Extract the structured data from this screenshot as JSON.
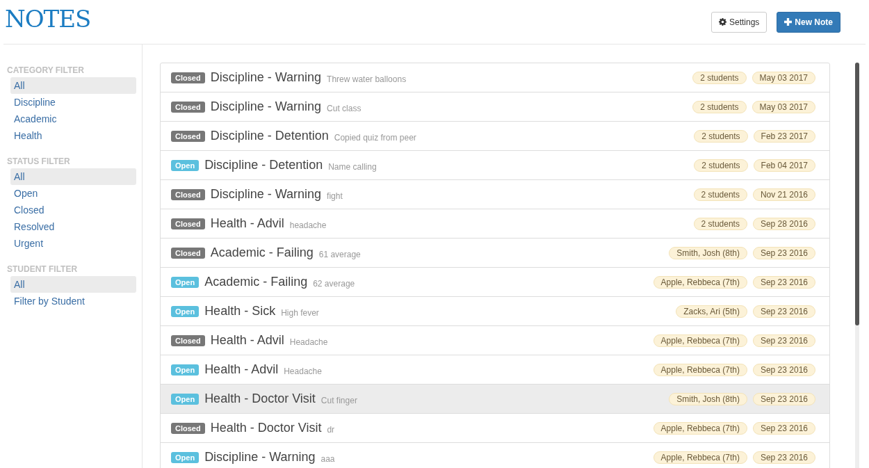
{
  "header": {
    "title": "NOTES",
    "buttons": [
      {
        "kind": "settings",
        "label": "Settings"
      },
      {
        "kind": "primary",
        "label": "New Note"
      }
    ]
  },
  "sidebar": {
    "sections": [
      {
        "heading": "CATEGORY FILTER",
        "items": [
          {
            "label": "All",
            "selected": true
          },
          {
            "label": "Discipline",
            "selected": false
          },
          {
            "label": "Academic",
            "selected": false
          },
          {
            "label": "Health",
            "selected": false
          }
        ]
      },
      {
        "heading": "STATUS FILTER",
        "items": [
          {
            "label": "All",
            "selected": true
          },
          {
            "label": "Open",
            "selected": false
          },
          {
            "label": "Closed",
            "selected": false
          },
          {
            "label": "Resolved",
            "selected": false
          },
          {
            "label": "Urgent",
            "selected": false
          }
        ]
      },
      {
        "heading": "STUDENT FILTER",
        "items": [
          {
            "label": "All",
            "selected": true
          },
          {
            "label": "Filter by Student",
            "selected": false
          }
        ]
      }
    ]
  },
  "notes": [
    {
      "status": "Closed",
      "title": "Discipline - Warning",
      "detail": "Threw water balloons",
      "students": "2 students",
      "date": "May 03 2017",
      "selected": false
    },
    {
      "status": "Closed",
      "title": "Discipline - Warning",
      "detail": "Cut class",
      "students": "2 students",
      "date": "May 03 2017",
      "selected": false
    },
    {
      "status": "Closed",
      "title": "Discipline - Detention",
      "detail": "Copied quiz from peer",
      "students": "2 students",
      "date": "Feb 23 2017",
      "selected": false
    },
    {
      "status": "Open",
      "title": "Discipline - Detention",
      "detail": "Name calling",
      "students": "2 students",
      "date": "Feb 04 2017",
      "selected": false
    },
    {
      "status": "Closed",
      "title": "Discipline - Warning",
      "detail": "fight",
      "students": "2 students",
      "date": "Nov 21 2016",
      "selected": false
    },
    {
      "status": "Closed",
      "title": "Health - Advil",
      "detail": "headache",
      "students": "2 students",
      "date": "Sep 28 2016",
      "selected": false
    },
    {
      "status": "Closed",
      "title": "Academic - Failing",
      "detail": "61 average",
      "students": "Smith, Josh (8th)",
      "date": "Sep 23 2016",
      "selected": false
    },
    {
      "status": "Open",
      "title": "Academic - Failing",
      "detail": "62 average",
      "students": "Apple, Rebbeca (7th)",
      "date": "Sep 23 2016",
      "selected": false
    },
    {
      "status": "Open",
      "title": "Health - Sick",
      "detail": "High fever",
      "students": "Zacks, Ari (5th)",
      "date": "Sep 23 2016",
      "selected": false
    },
    {
      "status": "Closed",
      "title": "Health - Advil",
      "detail": "Headache",
      "students": "Apple, Rebbeca (7th)",
      "date": "Sep 23 2016",
      "selected": false
    },
    {
      "status": "Open",
      "title": "Health - Advil",
      "detail": "Headache",
      "students": "Apple, Rebbeca (7th)",
      "date": "Sep 23 2016",
      "selected": false
    },
    {
      "status": "Open",
      "title": "Health - Doctor Visit",
      "detail": "Cut finger",
      "students": "Smith, Josh (8th)",
      "date": "Sep 23 2016",
      "selected": true
    },
    {
      "status": "Closed",
      "title": "Health - Doctor Visit",
      "detail": "dr",
      "students": "Apple, Rebbeca (7th)",
      "date": "Sep 23 2016",
      "selected": false
    },
    {
      "status": "Open",
      "title": "Discipline - Warning",
      "detail": "aaa",
      "students": "Apple, Rebbeca (7th)",
      "date": "Sep 23 2016",
      "selected": false
    }
  ]
}
